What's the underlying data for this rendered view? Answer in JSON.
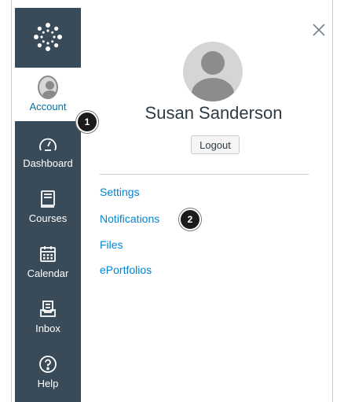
{
  "nav": {
    "items": [
      {
        "label": "Account",
        "icon": "user-avatar-icon",
        "active": true
      },
      {
        "label": "Dashboard",
        "icon": "dashboard-icon"
      },
      {
        "label": "Courses",
        "icon": "courses-book-icon"
      },
      {
        "label": "Calendar",
        "icon": "calendar-icon"
      },
      {
        "label": "Inbox",
        "icon": "inbox-icon"
      },
      {
        "label": "Help",
        "icon": "help-icon"
      }
    ]
  },
  "badges": {
    "one": "1",
    "two": "2"
  },
  "tray": {
    "user_name": "Susan Sanderson",
    "logout_label": "Logout",
    "links": [
      "Settings",
      "Notifications",
      "Files",
      "ePortfolios"
    ]
  },
  "colors": {
    "nav_bg": "#394b58",
    "active_text": "#0770a3",
    "link": "#0084d1",
    "badge": "#1b1b1b"
  }
}
